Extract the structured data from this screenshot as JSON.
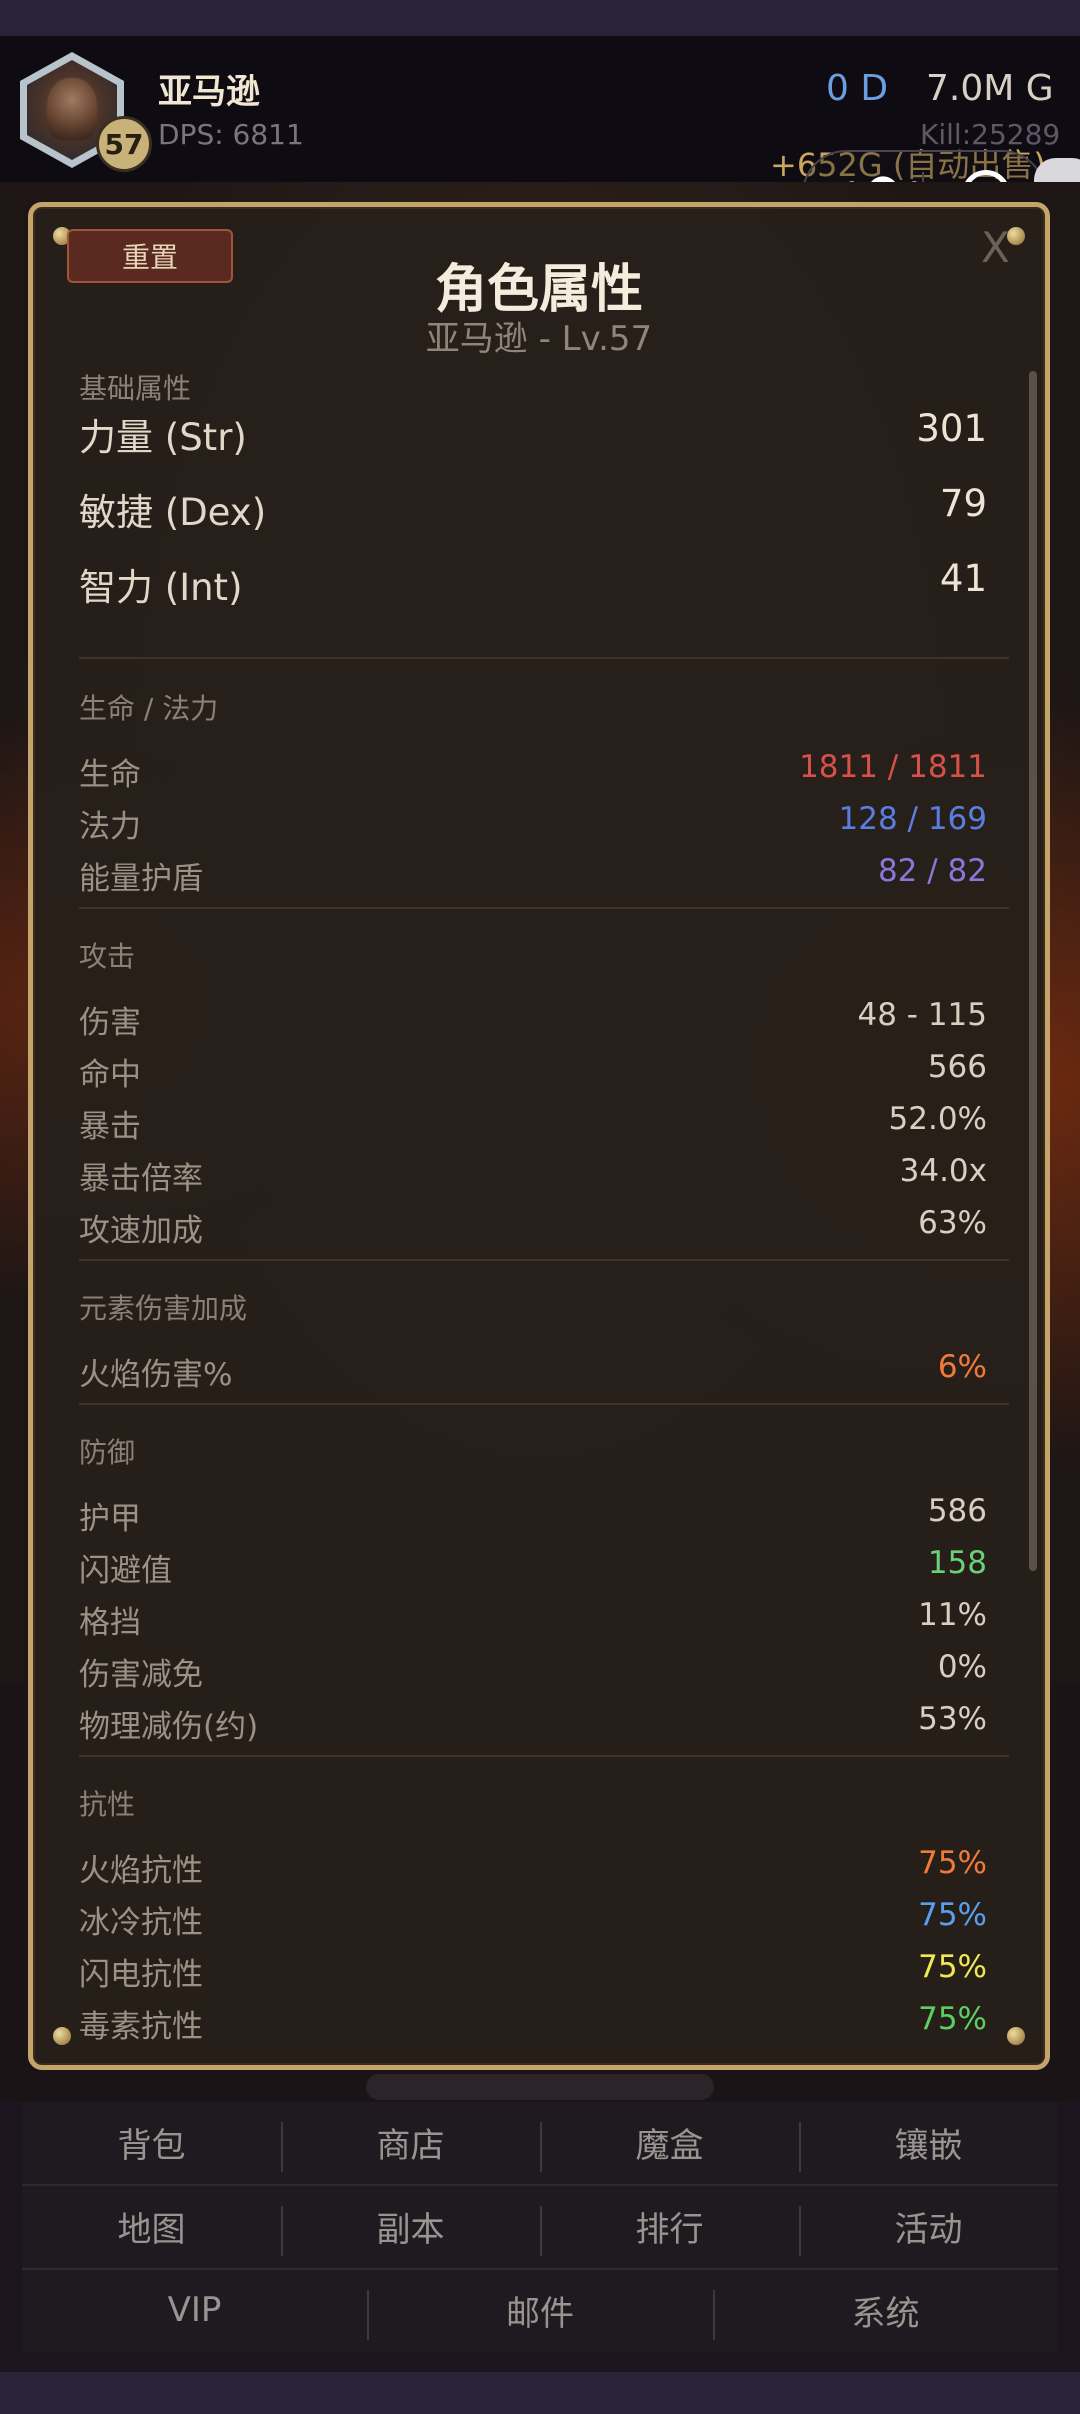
{
  "header": {
    "hero_name": "亚马逊",
    "level": "57",
    "dps": "DPS: 6811",
    "currency_d": "0 D",
    "currency_g": "7.0M G",
    "kill": "Kill:25289",
    "auto_sell": "+652G (自动出售)",
    "capsule_dots": "•●•"
  },
  "modal": {
    "reset_label": "重置",
    "close_label": "X",
    "title": "角色属性",
    "subtitle": "亚马逊 - Lv.57",
    "sections": {
      "basic": {
        "title": "基础属性",
        "rows": [
          {
            "label": "力量 (Str)",
            "value": "301"
          },
          {
            "label": "敏捷 (Dex)",
            "value": "79"
          },
          {
            "label": "智力 (Int)",
            "value": "41"
          }
        ]
      },
      "life_mana": {
        "title": "生命 / 法力",
        "rows": [
          {
            "label": "生命",
            "value": "1811 / 1811",
            "color": "#d8504a"
          },
          {
            "label": "法力",
            "value": "128 / 169",
            "color": "#5a7ee0"
          },
          {
            "label": "能量护盾",
            "value": "82 / 82",
            "color": "#8a78d8"
          }
        ]
      },
      "attack": {
        "title": "攻击",
        "rows": [
          {
            "label": "伤害",
            "value": "48 - 115"
          },
          {
            "label": "命中",
            "value": "566"
          },
          {
            "label": "暴击",
            "value": "52.0%"
          },
          {
            "label": "暴击倍率",
            "value": "34.0x"
          },
          {
            "label": "攻速加成",
            "value": "63%"
          }
        ]
      },
      "elemental": {
        "title": "元素伤害加成",
        "rows": [
          {
            "label": "火焰伤害%",
            "value": "6%",
            "color": "#f07a3a"
          }
        ]
      },
      "defense": {
        "title": "防御",
        "rows": [
          {
            "label": "护甲",
            "value": "586"
          },
          {
            "label": "闪避值",
            "value": "158",
            "color": "#6ad07a"
          },
          {
            "label": "格挡",
            "value": "11%"
          },
          {
            "label": "伤害减免",
            "value": "0%"
          },
          {
            "label": "物理减伤(约)",
            "value": "53%"
          }
        ]
      },
      "resist": {
        "title": "抗性",
        "rows": [
          {
            "label": "火焰抗性",
            "value": "75%",
            "color": "#f07a3a"
          },
          {
            "label": "冰冷抗性",
            "value": "75%",
            "color": "#5a9ef0"
          },
          {
            "label": "闪电抗性",
            "value": "75%",
            "color": "#f0e850"
          },
          {
            "label": "毒素抗性",
            "value": "75%",
            "color": "#5ad060"
          }
        ]
      }
    }
  },
  "nav": {
    "row1": [
      "背包",
      "商店",
      "魔盒",
      "镶嵌"
    ],
    "row2": [
      "地图",
      "副本",
      "排行",
      "活动"
    ],
    "row3": [
      "VIP",
      "邮件",
      "系统"
    ]
  }
}
